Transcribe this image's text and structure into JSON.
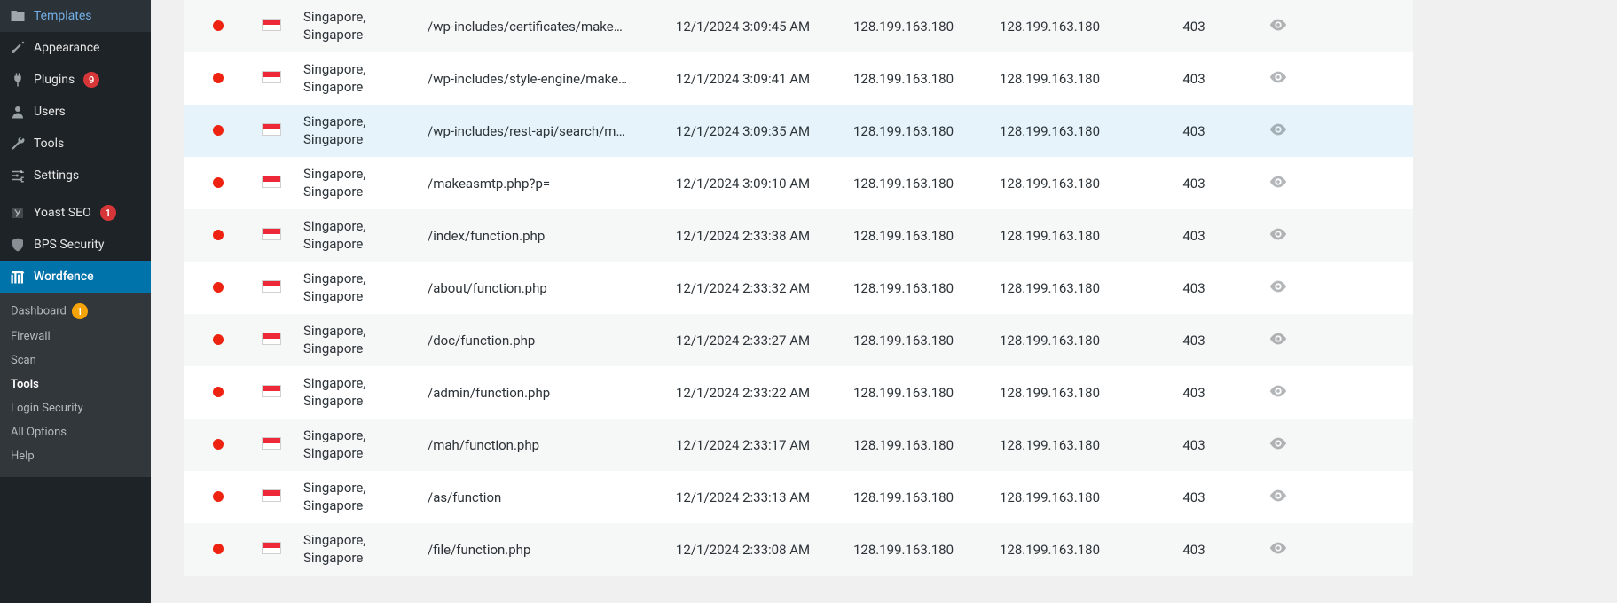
{
  "sidebar": {
    "top": [
      {
        "icon": "folder",
        "label": "Templates",
        "badge": null
      },
      {
        "icon": "brush",
        "label": "Appearance",
        "badge": null
      },
      {
        "icon": "plug",
        "label": "Plugins",
        "badge": "9"
      },
      {
        "icon": "user",
        "label": "Users",
        "badge": null
      },
      {
        "icon": "wrench",
        "label": "Tools",
        "badge": null
      },
      {
        "icon": "sliders",
        "label": "Settings",
        "badge": null
      }
    ],
    "mid": [
      {
        "icon": "yoast",
        "label": "Yoast SEO",
        "badge": "1"
      },
      {
        "icon": "shield",
        "label": "BPS Security",
        "badge": null
      }
    ],
    "active": {
      "icon": "wflogo",
      "label": "Wordfence"
    },
    "submenu": [
      {
        "label": "Dashboard",
        "badge": "1",
        "current": false
      },
      {
        "label": "Firewall",
        "badge": null,
        "current": false
      },
      {
        "label": "Scan",
        "badge": null,
        "current": false
      },
      {
        "label": "Tools",
        "badge": null,
        "current": true
      },
      {
        "label": "Login Security",
        "badge": null,
        "current": false
      },
      {
        "label": "All Options",
        "badge": null,
        "current": false
      },
      {
        "label": "Help",
        "badge": null,
        "current": false
      }
    ]
  },
  "traffic": {
    "rows": [
      {
        "location": "Singapore, Singapore",
        "path": "/wp-includes/certificates/make…",
        "time": "12/1/2024 3:09:45 AM",
        "ip1": "128.199.163.180",
        "ip2": "128.199.163.180",
        "status": "403",
        "hl": false
      },
      {
        "location": "Singapore, Singapore",
        "path": "/wp-includes/style-engine/make…",
        "time": "12/1/2024 3:09:41 AM",
        "ip1": "128.199.163.180",
        "ip2": "128.199.163.180",
        "status": "403",
        "hl": false
      },
      {
        "location": "Singapore, Singapore",
        "path": "/wp-includes/rest-api/search/m…",
        "time": "12/1/2024 3:09:35 AM",
        "ip1": "128.199.163.180",
        "ip2": "128.199.163.180",
        "status": "403",
        "hl": true
      },
      {
        "location": "Singapore, Singapore",
        "path": "/makeasmtp.php?p=",
        "time": "12/1/2024 3:09:10 AM",
        "ip1": "128.199.163.180",
        "ip2": "128.199.163.180",
        "status": "403",
        "hl": false
      },
      {
        "location": "Singapore, Singapore",
        "path": "/index/function.php",
        "time": "12/1/2024 2:33:38 AM",
        "ip1": "128.199.163.180",
        "ip2": "128.199.163.180",
        "status": "403",
        "hl": false
      },
      {
        "location": "Singapore, Singapore",
        "path": "/about/function.php",
        "time": "12/1/2024 2:33:32 AM",
        "ip1": "128.199.163.180",
        "ip2": "128.199.163.180",
        "status": "403",
        "hl": false
      },
      {
        "location": "Singapore, Singapore",
        "path": "/doc/function.php",
        "time": "12/1/2024 2:33:27 AM",
        "ip1": "128.199.163.180",
        "ip2": "128.199.163.180",
        "status": "403",
        "hl": false
      },
      {
        "location": "Singapore, Singapore",
        "path": "/admin/function.php",
        "time": "12/1/2024 2:33:22 AM",
        "ip1": "128.199.163.180",
        "ip2": "128.199.163.180",
        "status": "403",
        "hl": false
      },
      {
        "location": "Singapore, Singapore",
        "path": "/mah/function.php",
        "time": "12/1/2024 2:33:17 AM",
        "ip1": "128.199.163.180",
        "ip2": "128.199.163.180",
        "status": "403",
        "hl": false
      },
      {
        "location": "Singapore, Singapore",
        "path": "/as/function",
        "time": "12/1/2024 2:33:13 AM",
        "ip1": "128.199.163.180",
        "ip2": "128.199.163.180",
        "status": "403",
        "hl": false
      },
      {
        "location": "Singapore, Singapore",
        "path": "/file/function.php",
        "time": "12/1/2024 2:33:08 AM",
        "ip1": "128.199.163.180",
        "ip2": "128.199.163.180",
        "status": "403",
        "hl": false
      }
    ]
  }
}
